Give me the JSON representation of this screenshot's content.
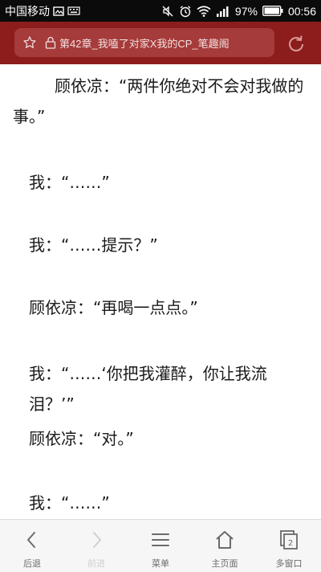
{
  "status_bar": {
    "carrier": "中国移动",
    "battery_percent": "97%",
    "time": "00:56"
  },
  "browser": {
    "url_title": "第42章_我嗑了对家X我的CP_笔趣阁"
  },
  "content": {
    "paragraphs": [
      "顾依凉：“两件你绝对不会对我做的事。”",
      "我：“……”",
      "我：“……提示？”",
      "顾依凉：“再喝一点点。”",
      "我：“……‘你把我灌醉，你让我流泪？’”",
      "顾依凉：“对。”",
      "我：“……”"
    ]
  },
  "bottom_nav": {
    "back": "后退",
    "forward": "前进",
    "menu": "菜单",
    "home": "主页面",
    "windows": "多窗口",
    "window_count": "2"
  },
  "colors": {
    "toolbar": "#8c1d1c",
    "url_field": "#a53b3a"
  }
}
